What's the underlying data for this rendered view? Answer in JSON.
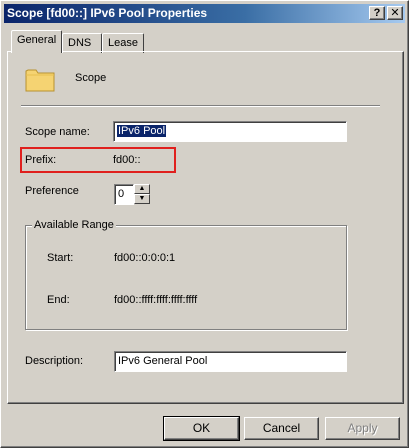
{
  "window": {
    "title": "Scope [fd00::] IPv6 Pool Properties",
    "help_button": "?",
    "close_button": "✕"
  },
  "tabs": [
    {
      "label": "General"
    },
    {
      "label": "DNS"
    },
    {
      "label": "Lease"
    }
  ],
  "general": {
    "header_label": "Scope",
    "scope_name_label": "Scope name:",
    "scope_name_value": "IPv6 Pool",
    "prefix_label": "Prefix:",
    "prefix_value": "fd00::",
    "preference_label": "Preference",
    "preference_value": "0",
    "available_range": {
      "title": "Available Range",
      "start_label": "Start:",
      "start_value": "fd00::0:0:0:1",
      "end_label": "End:",
      "end_value": "fd00::ffff:ffff:ffff:ffff"
    },
    "description_label": "Description:",
    "description_value": "IPv6 General Pool"
  },
  "buttons": {
    "ok": "OK",
    "cancel": "Cancel",
    "apply": "Apply"
  },
  "colors": {
    "highlight": "#e0201e",
    "title_bar": "#0a246a"
  }
}
